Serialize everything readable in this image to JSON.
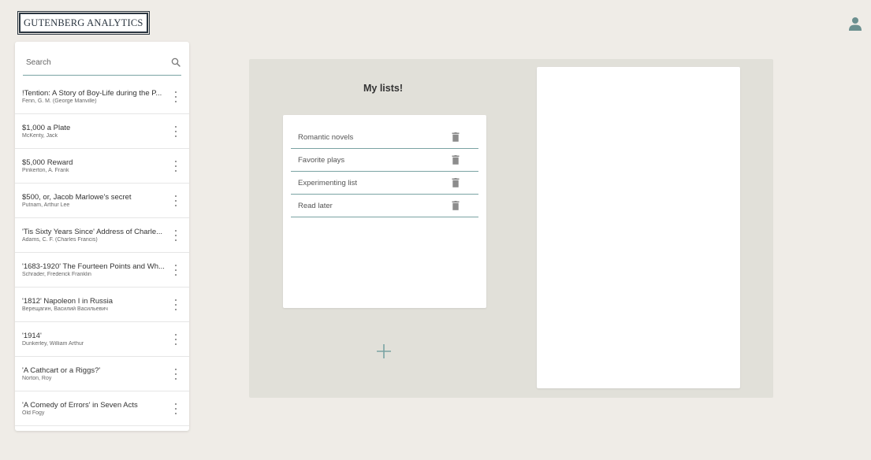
{
  "app": {
    "logo_text": "GUTENBERG ANALYTICS"
  },
  "icons": {
    "user": "user-icon",
    "search": "search-icon",
    "more": "kebab-icon",
    "delete": "trash-icon",
    "add": "plus-icon"
  },
  "colors": {
    "background": "#efece7",
    "panel": "#e1e0d9",
    "accent": "#7aa3a3",
    "user_icon": "#6b8f8f"
  },
  "sidebar": {
    "search": {
      "placeholder": "Search",
      "value": ""
    },
    "books": [
      {
        "title": "!Tention: A Story of Boy-Life during the P...",
        "author": "Fenn, G. M. (George Manville)"
      },
      {
        "title": "$1,000 a Plate",
        "author": "McKenty, Jack"
      },
      {
        "title": "$5,000 Reward",
        "author": "Pinkerton, A. Frank"
      },
      {
        "title": "$500, or, Jacob Marlowe's secret",
        "author": "Putnam, Arthur Lee"
      },
      {
        "title": "'Tis Sixty Years Since' Address of Charle...",
        "author": "Adams, C. F. (Charles Francis)"
      },
      {
        "title": "'1683-1920' The Fourteen Points and Wh...",
        "author": "Schrader, Frederick Franklin"
      },
      {
        "title": "'1812' Napoleon I in Russia",
        "author": "Верещагин, Василий Васильевич"
      },
      {
        "title": "'1914'",
        "author": "Dunkerley, William Arthur"
      },
      {
        "title": "'A Cathcart or a Riggs?'",
        "author": "Norton, Roy"
      },
      {
        "title": "'A Comedy of Errors' in Seven Acts",
        "author": "Old Fogy"
      }
    ]
  },
  "main": {
    "heading": "My lists!",
    "lists": [
      {
        "name": "Romantic novels"
      },
      {
        "name": "Favorite plays"
      },
      {
        "name": "Experimenting list"
      },
      {
        "name": "Read later"
      }
    ]
  }
}
